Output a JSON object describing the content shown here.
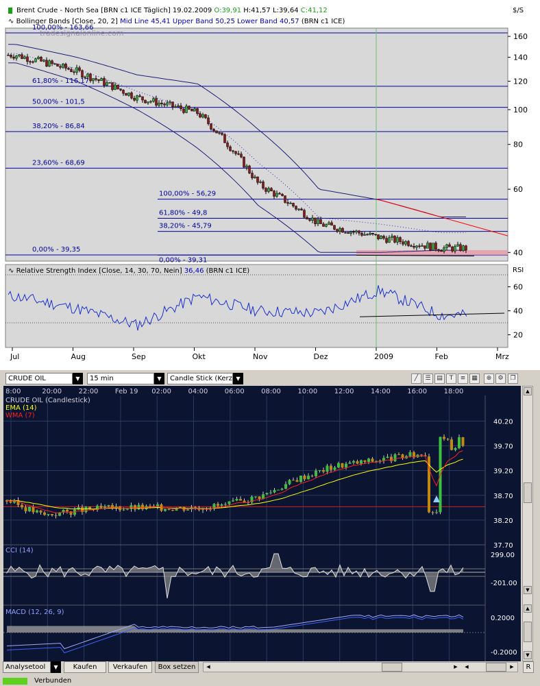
{
  "top": {
    "header_line": "Brent Crude - North Sea [BRN c1 ICE  Täglich] 19.02.2009",
    "ohlc_open": "O:39,91",
    "ohlc_high": "H:41,57",
    "ohlc_low": "L:39,64",
    "ohlc_close": "C:41,12",
    "unit": "$/S",
    "bb_label": "Bollinger Bands [Close, 20, 2]",
    "bb_values": "Mid Line 45,41 Upper Band 50,25 Lower Band 40,57",
    "bb_instrument": "(BRN c1 ICE)",
    "watermark": "tradesignalonline.com",
    "y_ticks": [
      "160",
      "140",
      "120",
      "100",
      "80",
      "60",
      "40"
    ],
    "fib_labels_1": [
      "100,00% - 163,66",
      "61,80% - 116,17",
      "50,00% - 101,5",
      "38,20% - 86,84",
      "23,60% - 68,69",
      "0,00% - 39,35"
    ],
    "fib_labels_2": [
      "100,00% - 56,29",
      "61,80% - 49,8",
      "38,20% - 45,79",
      "0,00% - 39,31"
    ],
    "rsi_label": "Relative Strength Index [Close, 14, 30, 70, Nein]",
    "rsi_value": "36,46",
    "rsi_instrument": "(BRN c1 ICE)",
    "rsi_unit": "RSI",
    "rsi_ticks": [
      "60",
      "40",
      "20"
    ],
    "x_ticks": [
      "Jul",
      "Aug",
      "Sep",
      "Okt",
      "Nov",
      "Dez",
      "2009",
      "Feb",
      "Mrz"
    ]
  },
  "bottom": {
    "symbol": "CRUDE OIL",
    "interval": "15 min",
    "chart_type": "Candle Stick (Kerze",
    "title": "CRUDE OIL (Candlestick)",
    "ema_label": "EMA (14)",
    "wma_label": "WMA (7)",
    "time_ticks": [
      "8:00",
      "20:00",
      "22:00",
      "Feb 19",
      "02:00",
      "04:00",
      "06:00",
      "08:00",
      "10:00",
      "12:00",
      "14:00",
      "16:00",
      "18:00"
    ],
    "price_ticks": [
      "40.20",
      "39.70",
      "39.20",
      "38.70",
      "38.20",
      "37.70"
    ],
    "cci_label": "CCI (14)",
    "cci_ticks": [
      "299.00",
      "-201.00"
    ],
    "macd_label": "MACD (12, 26, 9)",
    "macd_ticks": [
      "0.2000",
      "-0.2000"
    ],
    "buttons": [
      "Analysetool",
      "Kaufen",
      "Verkaufen",
      "Box setzen"
    ],
    "scroll_right": "R",
    "status_text": "Verbunden"
  },
  "colors": {
    "bb_line": "#1d1d7a",
    "fib_line": "#0000a0",
    "rsi_line": "#1a2fd0",
    "resistance": "#ff0000",
    "ema": "#ffff00",
    "wma": "#ff2020",
    "bottom_bg": "#0b1430",
    "up_candle": "#3fbf3f",
    "down_candle": "#c08a10"
  },
  "chart_data": [
    {
      "type": "line",
      "title": "Brent Crude - North Sea [BRN c1 ICE  Täglich] 19.02.2009",
      "ylabel": "$/S",
      "ylim": [
        38,
        168
      ],
      "x": [
        "Jul",
        "Aug",
        "Sep",
        "Okt",
        "Nov",
        "Dez",
        "2009",
        "Feb"
      ],
      "series": [
        {
          "name": "Close",
          "values": [
            142,
            128,
            108,
            98,
            62,
            48,
            44,
            41.12
          ]
        },
        {
          "name": "Upper Band",
          "values": [
            152,
            140,
            125,
            118,
            88,
            60,
            56,
            50.25
          ]
        },
        {
          "name": "Lower Band",
          "values": [
            135,
            120,
            100,
            78,
            54,
            40,
            40,
            40.57
          ]
        }
      ],
      "fibonacci_1": [
        163.66,
        116.17,
        101.5,
        86.84,
        68.69,
        39.35
      ],
      "fibonacci_2": [
        56.29,
        49.8,
        45.79,
        39.31
      ]
    },
    {
      "type": "line",
      "title": "Relative Strength Index [Close, 14, 30, 70, Nein]",
      "ylim": [
        10,
        78
      ],
      "x": [
        "Jul",
        "Aug",
        "Sep",
        "Okt",
        "Nov",
        "Dez",
        "2009",
        "Feb"
      ],
      "series": [
        {
          "name": "RSI",
          "values": [
            52,
            42,
            28,
            52,
            40,
            38,
            57,
            36.46
          ]
        }
      ]
    },
    {
      "type": "line",
      "title": "CRUDE OIL (Candlestick)",
      "ylim": [
        37.7,
        40.4
      ],
      "x": [
        "8:00",
        "20:00",
        "22:00",
        "Feb 19",
        "02:00",
        "04:00",
        "06:00",
        "08:00",
        "10:00",
        "12:00",
        "14:00",
        "16:00",
        "18:00"
      ],
      "series": [
        {
          "name": "Close",
          "values": [
            38.6,
            38.3,
            38.4,
            38.45,
            38.45,
            38.45,
            38.5,
            38.7,
            39.05,
            39.3,
            39.4,
            39.5,
            39.6
          ]
        }
      ]
    }
  ]
}
